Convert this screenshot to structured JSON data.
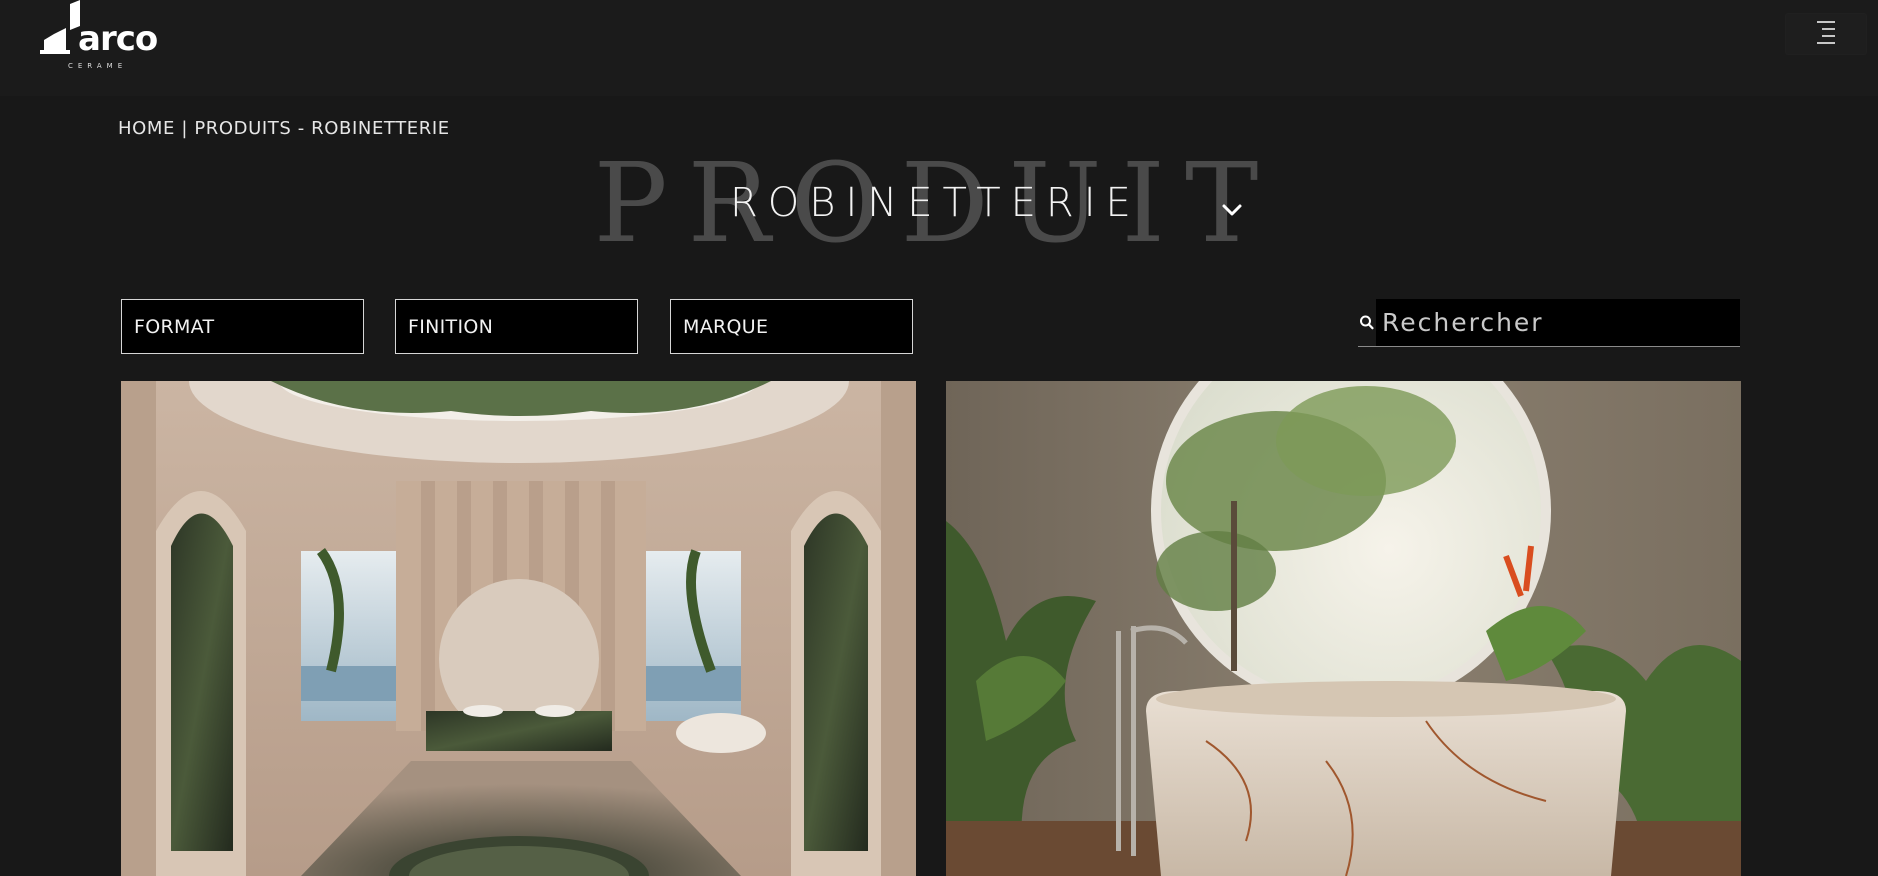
{
  "header": {
    "logo_text": "arco",
    "logo_subtext": "CERAME",
    "menu_icon": "hamburger-menu-icon"
  },
  "breadcrumb": "HOME | PRODUITS - ROBINETTERIE",
  "page": {
    "background_word": "PRODUIT",
    "title": "ROBINETTERIE",
    "dropdown_icon": "chevron-down-icon"
  },
  "filters": [
    {
      "label": "FORMAT"
    },
    {
      "label": "FINITION"
    },
    {
      "label": "MARQUE"
    }
  ],
  "search": {
    "placeholder": "Rechercher",
    "icon": "search-icon"
  },
  "products": [
    {
      "image": "luxury-bathroom-arches-double-sink"
    },
    {
      "image": "outdoor-marble-bathtub-round-window"
    }
  ],
  "colors": {
    "background": "#181818",
    "header_background": "#1b1b1b",
    "text": "#e8e8e8",
    "background_word": "#4a4a4a",
    "filter_background": "#000000",
    "filter_border": "#d6d6d6"
  }
}
